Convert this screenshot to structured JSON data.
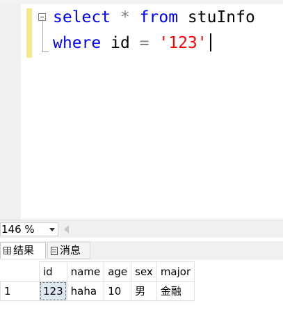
{
  "editor": {
    "line1": {
      "kw1": "select",
      "op": "*",
      "kw2": "from",
      "ident": "stuInfo"
    },
    "line2": {
      "kw": "where",
      "ident": "id",
      "op": "=",
      "str": "'123'"
    }
  },
  "zoom": {
    "value": "146 %"
  },
  "tabs": [
    {
      "label": "结果",
      "icon": "grid-icon"
    },
    {
      "label": "消息",
      "icon": "message-icon"
    }
  ],
  "results": {
    "columns": [
      "id",
      "name",
      "age",
      "sex",
      "major"
    ],
    "rows": [
      {
        "num": "1",
        "cells": [
          "123",
          "haha",
          "10",
          "男",
          "金融"
        ]
      }
    ]
  },
  "colors": {
    "keyword": "#0000ff",
    "string": "#ff0000",
    "operator": "#808080",
    "change_bar": "#f5eb8e"
  }
}
